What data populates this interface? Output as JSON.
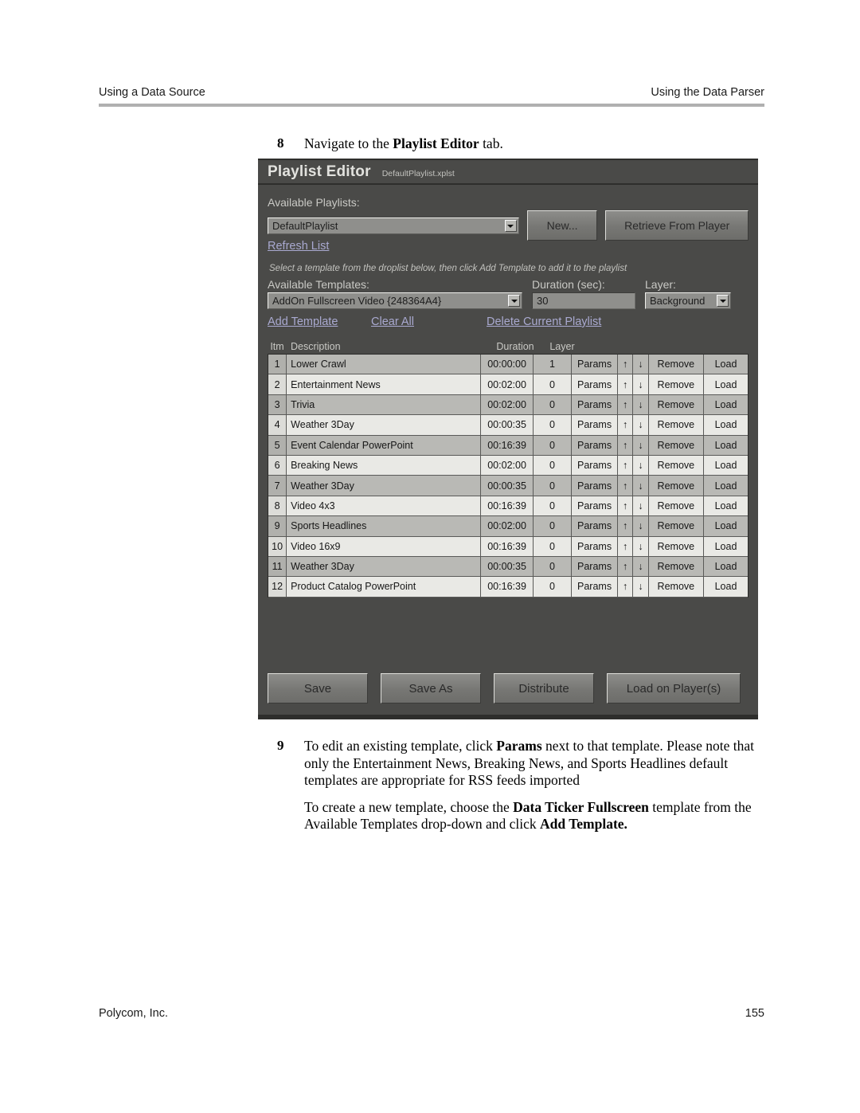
{
  "page_header": {
    "left": "Using a Data Source",
    "right": "Using the Data Parser"
  },
  "page_footer": {
    "company": "Polycom, Inc.",
    "page_number": "155"
  },
  "steps": {
    "step8": {
      "number": "8",
      "text_before": "Navigate to the ",
      "bold": "Playlist Editor",
      "text_after": " tab."
    },
    "step9": {
      "number": "9",
      "p1_a": "To edit an existing template, click ",
      "p1_b": "Params",
      "p1_c": " next to that template. Please note that only the Entertainment News, Breaking News, and Sports Headlines default templates are appropriate for RSS feeds imported",
      "p2_a": "To create a new template, choose the ",
      "p2_b": "Data Ticker Fullscreen",
      "p2_c": " template from the Available Templates drop-down and click ",
      "p2_d": "Add Template."
    }
  },
  "app": {
    "title": "Playlist Editor",
    "filename": "DefaultPlaylist.xplst",
    "colors": {
      "panel": "#4a4a48",
      "chrome": "#2e2e2c",
      "link": "#a9a9d0",
      "row": "#b9b9b5",
      "row_alt": "#e9e9e5"
    },
    "playlists": {
      "label": "Available Playlists:",
      "selected": "DefaultPlaylist",
      "new_button": "New...",
      "retrieve_button": "Retrieve From Player",
      "refresh_link": "Refresh List"
    },
    "hint": "Select a template from the droplist below, then click Add Template to add it to the playlist",
    "templates": {
      "label": "Available Templates:",
      "selected": "AddOn Fullscreen Video {248364A4}",
      "duration_label": "Duration (sec):",
      "duration_value": "30",
      "layer_label": "Layer:",
      "layer_value": "Background",
      "add_template_link": "Add Template",
      "clear_all_link": "Clear All",
      "delete_playlist_link": "Delete Current Playlist"
    },
    "table": {
      "headers": {
        "itm": "Itm",
        "description": "Description",
        "duration": "Duration",
        "layer": "Layer"
      },
      "actions": {
        "params": "Params",
        "up": "↑",
        "down": "↓",
        "remove": "Remove",
        "load": "Load"
      },
      "rows": [
        {
          "itm": "1",
          "description": "Lower Crawl",
          "duration": "00:00:00",
          "layer": "1"
        },
        {
          "itm": "2",
          "description": "Entertainment News",
          "duration": "00:02:00",
          "layer": "0"
        },
        {
          "itm": "3",
          "description": "Trivia",
          "duration": "00:02:00",
          "layer": "0"
        },
        {
          "itm": "4",
          "description": "Weather 3Day",
          "duration": "00:00:35",
          "layer": "0"
        },
        {
          "itm": "5",
          "description": "Event Calendar PowerPoint",
          "duration": "00:16:39",
          "layer": "0"
        },
        {
          "itm": "6",
          "description": "Breaking News",
          "duration": "00:02:00",
          "layer": "0"
        },
        {
          "itm": "7",
          "description": "Weather 3Day",
          "duration": "00:00:35",
          "layer": "0"
        },
        {
          "itm": "8",
          "description": "Video 4x3",
          "duration": "00:16:39",
          "layer": "0"
        },
        {
          "itm": "9",
          "description": "Sports Headlines",
          "duration": "00:02:00",
          "layer": "0"
        },
        {
          "itm": "10",
          "description": "Video 16x9",
          "duration": "00:16:39",
          "layer": "0"
        },
        {
          "itm": "11",
          "description": "Weather 3Day",
          "duration": "00:00:35",
          "layer": "0"
        },
        {
          "itm": "12",
          "description": "Product Catalog PowerPoint",
          "duration": "00:16:39",
          "layer": "0"
        }
      ]
    },
    "footer_buttons": {
      "save": "Save",
      "save_as": "Save As",
      "distribute": "Distribute",
      "load_on_players": "Load on Player(s)"
    }
  }
}
